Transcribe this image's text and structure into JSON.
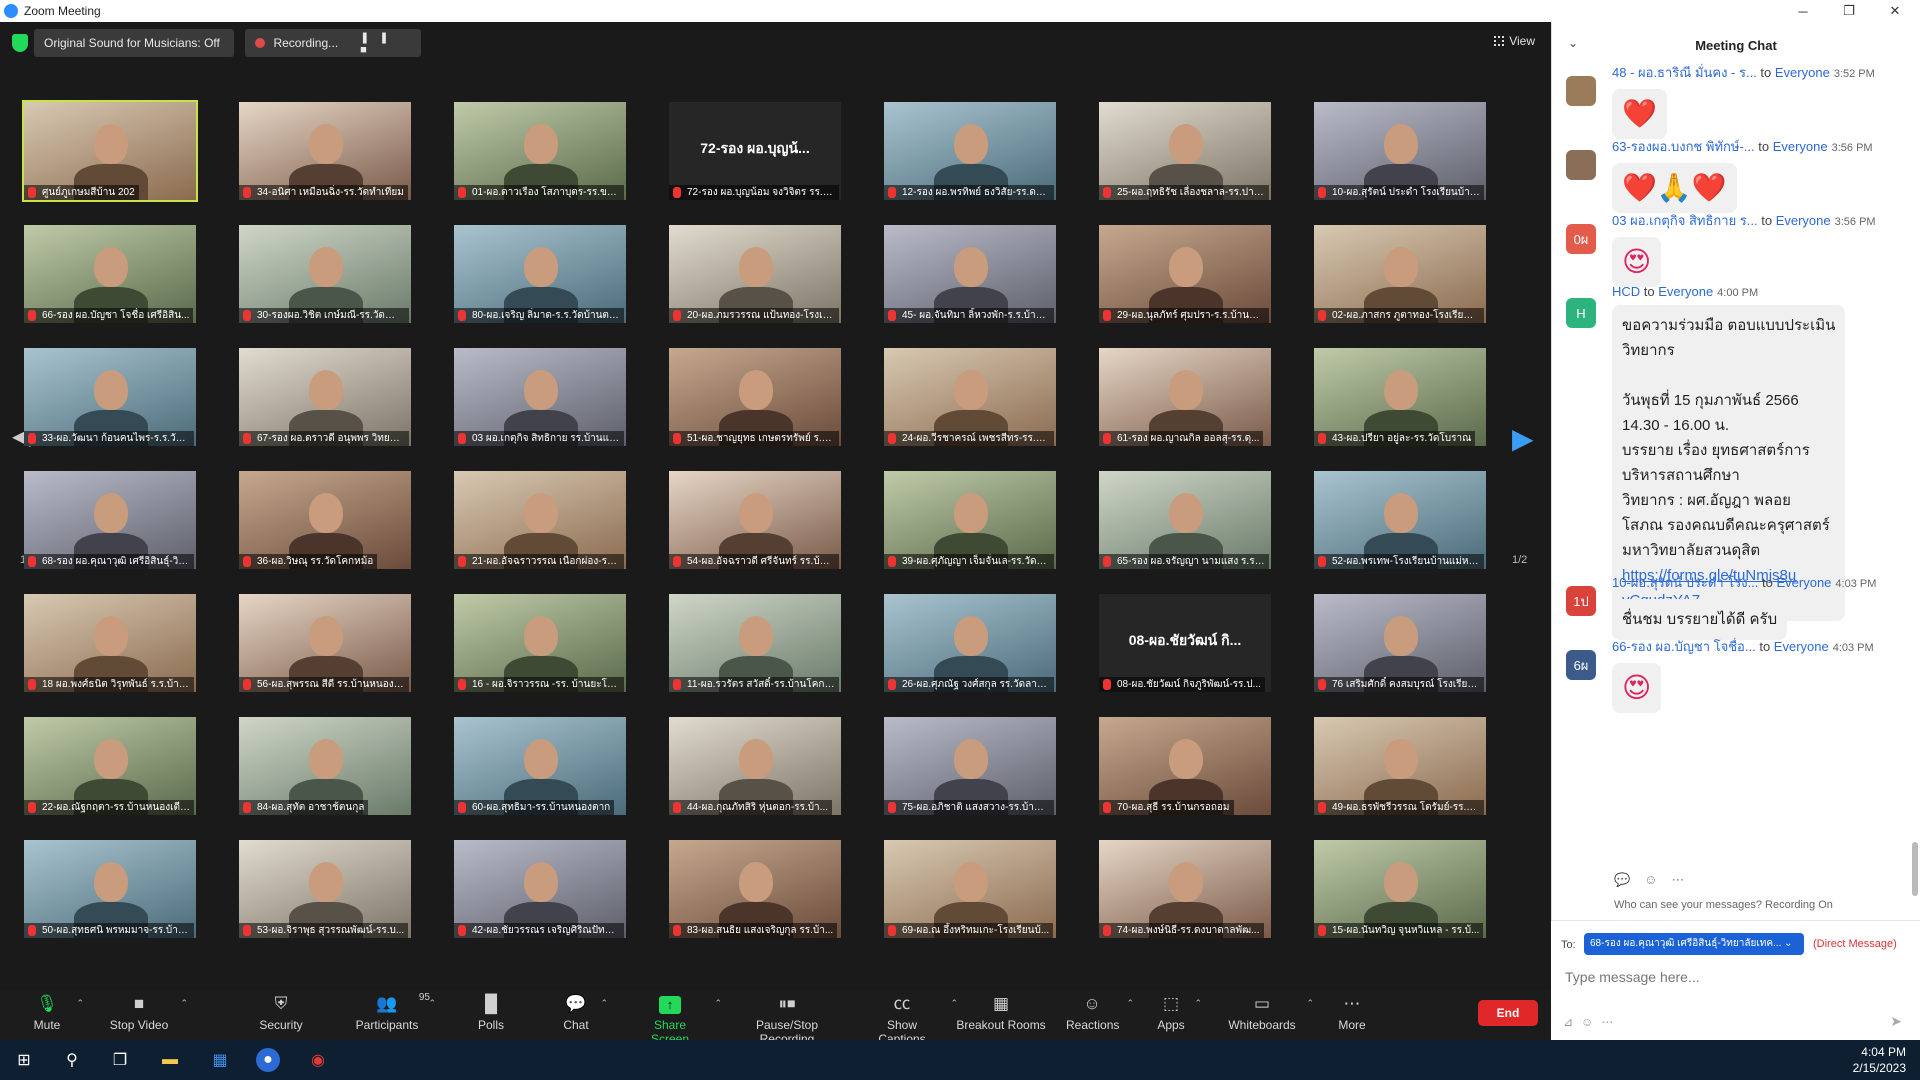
{
  "window": {
    "title": "Zoom Meeting"
  },
  "topbar": {
    "original_sound": "Original Sound for Musicians: Off",
    "recording": "Recording...",
    "view": "View"
  },
  "pagination": {
    "left": "1/2",
    "right": "1/2"
  },
  "tiles": [
    {
      "name": "ศูนย์ภูเกษมสีบ้าน 202",
      "big": ""
    },
    {
      "name": "34-อนิศา เหมือนฉิ่ง-รร.วัดทำเทียม",
      "big": ""
    },
    {
      "name": "01-ผอ.ดาวเรือง โสภาบุตร-รร.ขมิ้น...",
      "big": ""
    },
    {
      "name": "72-รอง ผอ.บุญน้อม จงวิจิตร รร.ชุ...",
      "big": "72-รอง ผอ.บุญน้..."
    },
    {
      "name": "12-รอง ผอ.พรทิพย์ ธงวิสัย-รร.ดน...",
      "big": ""
    },
    {
      "name": "25-ผอ.ฤทธิรัช เลื่องชลาล-รร.ปากด...",
      "big": ""
    },
    {
      "name": "10-ผอ.สุรัตน์ ประดำ โรงเรียนบ้านไ...",
      "big": ""
    },
    {
      "name": "66-รอง ผอ.บัญชา โจชื่อ เศรีอิสิน...",
      "big": ""
    },
    {
      "name": "30-รองผอ.วิชิต เกษ์มณี-รร.วัดสำโรง",
      "big": ""
    },
    {
      "name": "80-ผอ.เจริญ ลิ่มาด-ร.ร.วัดบ้านตาก...",
      "big": ""
    },
    {
      "name": "20-ผอ.ภมรวรรณ แป้นทอง-โรงเรีย...",
      "big": ""
    },
    {
      "name": "45- ผอ.จันทิมา ลิ้หวงพัก-ร.ร.บ้านหน...",
      "big": ""
    },
    {
      "name": "29-ผอ.นุลภัทร์ ศุมปรา-ร.ร.บ้านกระนี...",
      "big": ""
    },
    {
      "name": "02-ผอ.ภาสกร ภูตาทอง-โรงเรียนอ...",
      "big": ""
    },
    {
      "name": "33-ผอ.วัฒนา ก้อนคนไพร-ร.ร.วัดบ...",
      "big": ""
    },
    {
      "name": "67-รอง ผอ.ดราวดี อนุพพร วิทยาลั...",
      "big": ""
    },
    {
      "name": "03 ผอ.เกตุกิจ สิทธิกาย รร.บ้านแม่ทุ...",
      "big": ""
    },
    {
      "name": "51-ผอ.ชาญยุทธ เกษตรทรัพย์ ร.ร.ชุม...",
      "big": ""
    },
    {
      "name": "24-ผอ.วีรชาครณ์ เพชรสีทร-รร.วัดอิน...",
      "big": ""
    },
    {
      "name": "61-รอง ผอ.ญาณกิล ออลสุ-รร.ดุ...",
      "big": ""
    },
    {
      "name": "43-ผอ.ปรียา อยู่ละ-รร.วัดโบราณ",
      "big": ""
    },
    {
      "name": "68-รอง ผอ.คุณาวุฒิ เศรีอิสินธุ์-วิท...",
      "big": ""
    },
    {
      "name": "36-ผอ.วิษณุ รร.วัดโคกหม้อ",
      "big": ""
    },
    {
      "name": "21-ผอ.อัจฉราวรรณ เนือกผ่อง-รร.บ้า...",
      "big": ""
    },
    {
      "name": "54-ผอ.อัจฉราวดี ศรีจันทร์ รร.บ้านพ...",
      "big": ""
    },
    {
      "name": "39-ผอ.ศุภัญญา เจ็มจั่นเล-รร.วัดหน...",
      "big": ""
    },
    {
      "name": "65-รอง ผอ.จรัญญา นามแสง ร.ร.ดี...",
      "big": ""
    },
    {
      "name": "52-ผอ.พรเทพ-โรงเรียนบ้านแม่หา...",
      "big": ""
    },
    {
      "name": "18 ผอ.พงศ์ธนิต วิรุทพันธ์ ร.ร.บ้าน...",
      "big": ""
    },
    {
      "name": "56-ผอ.สุพรรณ สีดี รร.บ้านหนองนาสุ...",
      "big": ""
    },
    {
      "name": "16 - ผอ.จิราวรรณ -รร. บ้านยะโต...",
      "big": ""
    },
    {
      "name": "11-ผอ.รวรัตร สวัสดิ์-รร.บ้านโคกยาว",
      "big": ""
    },
    {
      "name": "26-ผอ.ศุภณัฐ วงศ์สกุล รร.วัดลาดกั...",
      "big": ""
    },
    {
      "name": "08-ผอ.ชัยวัฒน์ กิจภูริพัฒน์-รร.ป...",
      "big": "08-ผอ.ชัยวัฒน์ กิ..."
    },
    {
      "name": "76 เสริมศักดิ์ คงสมบุรณ์ โรงเรียนวัดบ...",
      "big": ""
    },
    {
      "name": "22-ผอ.ณัฐกฤตา-รร.บ้านหนองเตียน",
      "big": ""
    },
    {
      "name": "84-ผอ.สุทัต อาชาช้ตนกุล",
      "big": ""
    },
    {
      "name": "60-ผอ.สุทธิมา-รร.บ้านหนองตาก",
      "big": ""
    },
    {
      "name": "44-ผอ.กุณภัทสิริ หุ่นตอก-รร.บ้า...",
      "big": ""
    },
    {
      "name": "75-ผอ.อภิชาติ แสงสวาง-รร.บ้านโค...",
      "big": ""
    },
    {
      "name": "70-ผอ.สุธี รร.บ้านกรอถอม",
      "big": ""
    },
    {
      "name": "49-ผอ.ธรพัชรีวรรณ โตรัมย์-รร.วั...",
      "big": ""
    },
    {
      "name": "50-ผอ.สุทธศนิ พรหมมาจ-รร.บ้าน...",
      "big": ""
    },
    {
      "name": "53-ผอ.จิราพุธ สุวรรณพัฒน์-รร.บ...",
      "big": ""
    },
    {
      "name": "42-ผอ.ชัยวรรณร เจริญศิริณปัทร-ร...",
      "big": ""
    },
    {
      "name": "83-ผอ.สนธิย แสงเจริญกุล รร.บ้า...",
      "big": ""
    },
    {
      "name": "69-ผอ.ณ อึ้งหริทมเกะ-โรงเรียนบ้...",
      "big": ""
    },
    {
      "name": "74-ผอ.พงษ์นิธี-รร.ดงบาดาลพัฒ...",
      "big": ""
    },
    {
      "name": "15-ผอ.นันทวิญ จุนหวิแหล - รร.บ้...",
      "big": ""
    }
  ],
  "toolbar": {
    "mute": "Mute",
    "stop_video": "Stop Video",
    "security": "Security",
    "participants": "Participants",
    "participants_count": "95",
    "polls": "Polls",
    "chat": "Chat",
    "share_screen": "Share Screen",
    "pause_stop_recording": "Pause/Stop Recording",
    "show_captions": "Show Captions",
    "breakout_rooms": "Breakout Rooms",
    "reactions": "Reactions",
    "apps": "Apps",
    "whiteboards": "Whiteboards",
    "more": "More",
    "end": "End"
  },
  "chat": {
    "title": "Meeting Chat",
    "messages": [
      {
        "sender": "48 - ผอ.ธาริณี มั่นคง - ร...",
        "to_label": "to",
        "to": "Everyone",
        "time": "3:52 PM",
        "avatar": "",
        "avatar_color": "#9a7b5a",
        "content": "❤️",
        "is_emoji": true
      },
      {
        "sender": "63-รองผอ.บงกช พิทักษ์-...",
        "to_label": "to",
        "to": "Everyone",
        "time": "3:56 PM",
        "avatar": "",
        "avatar_color": "#8a6e58",
        "content": "❤️🙏❤️",
        "is_emoji": true
      },
      {
        "sender": "03 ผอ.เกตุกิจ สิทธิกาย ร...",
        "to_label": "to",
        "to": "Everyone",
        "time": "3:56 PM",
        "avatar": "0ผ",
        "avatar_color": "#e25b4b",
        "content": "😍",
        "is_emoji": true
      },
      {
        "sender": "HCD",
        "to_label": "to",
        "to": "Everyone",
        "time": "4:00 PM",
        "avatar": "H",
        "avatar_color": "#2db37d",
        "content_lines": [
          "ขอความร่วมมือ ตอบแบบประเมิน",
          "วิทยากร",
          "",
          "วันพุธที่ 15 กุมภาพันธ์ 2566",
          "14.30 - 16.00 น.",
          "บรรยาย เรื่อง  ยุทธศาสตร์การ",
          "บริหารสถานศึกษา",
          "วิทยากร :   ผศ.อัญฎา  พลอย",
          "โสภณ  รองคณบดีคณะครุศาสตร์",
          "มหาวิทยาลัยสวนดุสิต"
        ],
        "link": "https://forms.gle/tuNmjs8uyCqudzYA7",
        "link_line1": "https://forms.gle/tuNmjs8u",
        "link_line2": "yCqudzYA7"
      },
      {
        "sender": "10-ผอ.สุรัตน์ ประดำ โรง...",
        "to_label": "to",
        "to": "Everyone",
        "time": "4:03 PM",
        "avatar": "1ป",
        "avatar_color": "#d9433b",
        "content": "ชื่นชม บรรยายได้ดี ครับ",
        "is_emoji": false
      },
      {
        "sender": "66-รอง ผอ.บัญชา โจชื่อ...",
        "to_label": "to",
        "to": "Everyone",
        "time": "4:03 PM",
        "avatar": "6ผ",
        "avatar_color": "#3c5a8a",
        "content": "😍",
        "is_emoji": true
      }
    ],
    "who_can_see": "Who can see your messages? Recording On",
    "to_label": "To:",
    "to_select": "68-รอง ผอ.คุณาวุฒิ เศรีอิสินธุ์-วิทยาลัยเทค...",
    "direct_message": "(Direct Message)",
    "placeholder": "Type message here..."
  },
  "taskbar": {
    "time": "4:04 PM",
    "date": "2/15/2023"
  },
  "colors": {
    "accent": "#2d8cff",
    "share_green": "#23d959",
    "end_red": "#e02828",
    "active_speaker": "#c9e24a"
  }
}
